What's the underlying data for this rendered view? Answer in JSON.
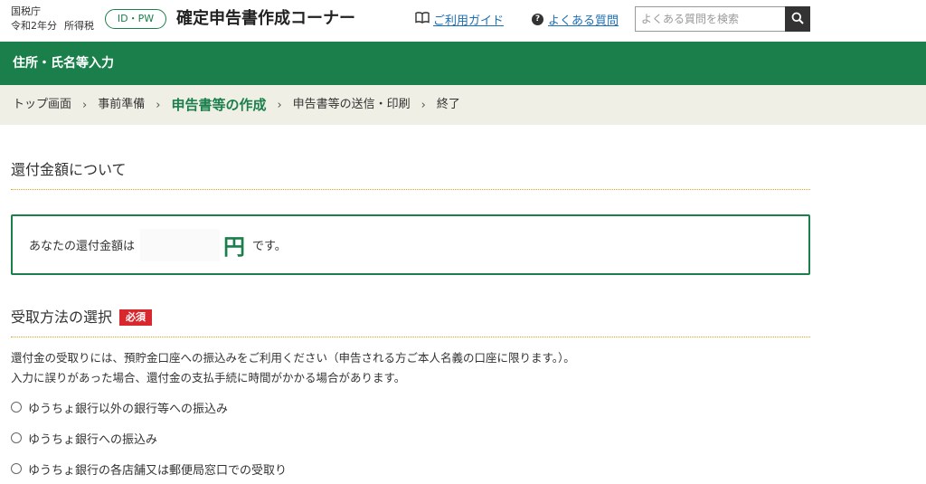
{
  "header": {
    "agency": "国税庁",
    "year": "令和2年分",
    "tax_type": "所得税",
    "id_badge": "ID・PW",
    "title": "確定申告書作成コーナー",
    "guide_link": "ご利用ガイド",
    "guide_icon": "book-icon",
    "faq_link": "よくある質問",
    "faq_icon": "question-circle-icon",
    "search": {
      "placeholder": "よくある質問を検索",
      "button_icon": "search-icon"
    }
  },
  "section_title": "住所・氏名等入力",
  "breadcrumb": {
    "items": [
      {
        "label": "トップ画面",
        "current": false
      },
      {
        "label": "事前準備",
        "current": false
      },
      {
        "label": "申告書等の作成",
        "current": true
      },
      {
        "label": "申告書等の送信・印刷",
        "current": false
      },
      {
        "label": "終了",
        "current": false
      }
    ],
    "separator": "›"
  },
  "refund": {
    "heading": "還付金額について",
    "prefix": "あなたの還付金額は",
    "amount": "",
    "unit": "円",
    "suffix": "です。"
  },
  "method": {
    "heading": "受取方法の選択",
    "required": "必須",
    "description_1": "還付金の受取りには、預貯金口座への振込みをご利用ください（申告される方ご本人名義の口座に限ります。）。",
    "description_2": "入力に誤りがあった場合、還付金の支払手続に時間がかかる場合があります。",
    "options": [
      "ゆうちょ銀行以外の銀行等への振込み",
      "ゆうちょ銀行への振込み",
      "ゆうちょ銀行の各店舗又は郵便局窓口での受取り"
    ]
  },
  "colors": {
    "brand_green": "#1a7f4b",
    "link_blue": "#1b6fb5",
    "required_red": "#d9272e",
    "breadcrumb_bg": "#f0efe6",
    "divider_orange": "#e0a020"
  }
}
